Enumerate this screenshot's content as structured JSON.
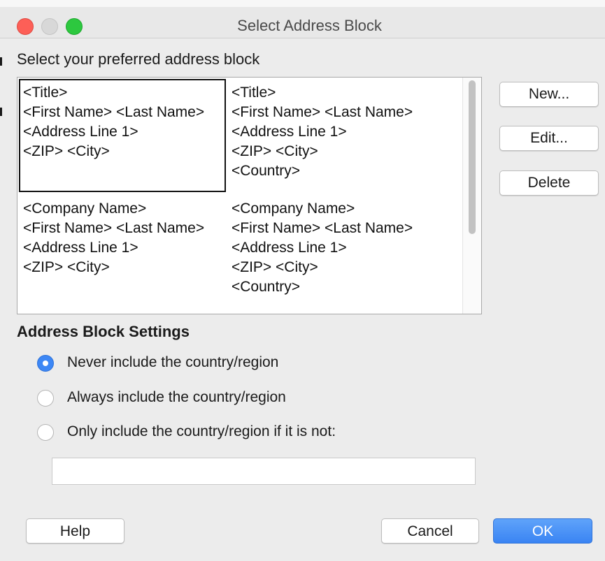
{
  "window": {
    "title": "Select Address Block"
  },
  "address_blocks": {
    "label": "Select your preferred address block",
    "blocks": [
      {
        "lines": [
          "<Title>",
          "<First Name> <Last Name>",
          "<Address Line 1>",
          "<ZIP> <City>"
        ],
        "selected": true
      },
      {
        "lines": [
          "<Title>",
          "<First Name> <Last Name>",
          "<Address Line 1>",
          "<ZIP> <City>",
          "<Country>"
        ],
        "selected": false
      },
      {
        "lines": [
          "<Company Name>",
          "<First Name> <Last Name>",
          "<Address Line 1>",
          "<ZIP> <City>"
        ],
        "selected": false
      },
      {
        "lines": [
          "<Company Name>",
          "<First Name> <Last Name>",
          "<Address Line 1>",
          "<ZIP> <City>",
          "<Country>"
        ],
        "selected": false
      }
    ]
  },
  "side_buttons": {
    "new_label": "New...",
    "edit_label": "Edit...",
    "delete_label": "Delete"
  },
  "settings": {
    "title": "Address Block Settings",
    "options": [
      {
        "label": "Never include the country/region",
        "checked": true
      },
      {
        "label": "Always include the country/region",
        "checked": false
      },
      {
        "label": "Only include the country/region if it is not:",
        "checked": false
      }
    ],
    "country_value": ""
  },
  "footer": {
    "help_label": "Help",
    "cancel_label": "Cancel",
    "ok_label": "OK"
  },
  "colors": {
    "accent": "#3d87f5",
    "close": "#fd5f57",
    "maximize": "#2dc83f"
  }
}
